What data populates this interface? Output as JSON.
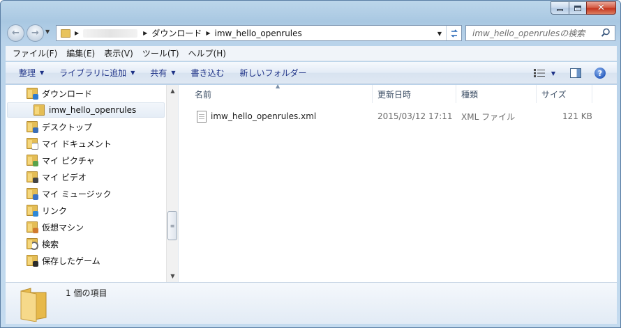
{
  "window": {
    "caption": {
      "min_icon": "minimize-icon",
      "max_icon": "maximize-icon",
      "close_glyph": "✕"
    }
  },
  "nav": {
    "back_icon": "back-arrow-icon",
    "forward_icon": "forward-arrow-icon",
    "address": {
      "crumbs": [
        "ダウンロード",
        "imw_hello_openrules"
      ],
      "refresh_icon": "refresh-icon"
    },
    "search": {
      "placeholder": "imw_hello_openrulesの検索",
      "icon": "search-icon"
    }
  },
  "menubar": {
    "items": [
      "ファイル(F)",
      "編集(E)",
      "表示(V)",
      "ツール(T)",
      "ヘルプ(H)"
    ]
  },
  "commandbar": {
    "organize": "整理",
    "add_to_library": "ライブラリに追加",
    "share": "共有",
    "burn": "書き込む",
    "new_folder": "新しいフォルダー"
  },
  "sidebar": {
    "items": [
      {
        "label": "ダウンロード",
        "icon": "downloads-folder-icon"
      },
      {
        "label": "imw_hello_openrules",
        "icon": "folder-icon",
        "selected": true
      },
      {
        "label": "デスクトップ",
        "icon": "desktop-folder-icon"
      },
      {
        "label": "マイ ドキュメント",
        "icon": "documents-folder-icon"
      },
      {
        "label": "マイ ピクチャ",
        "icon": "pictures-folder-icon"
      },
      {
        "label": "マイ ビデオ",
        "icon": "videos-folder-icon"
      },
      {
        "label": "マイ ミュージック",
        "icon": "music-folder-icon"
      },
      {
        "label": "リンク",
        "icon": "links-folder-icon"
      },
      {
        "label": "仮想マシン",
        "icon": "virtual-machines-folder-icon"
      },
      {
        "label": "検索",
        "icon": "searches-folder-icon"
      },
      {
        "label": "保存したゲーム",
        "icon": "saved-games-folder-icon"
      }
    ]
  },
  "filelist": {
    "columns": [
      "名前",
      "更新日時",
      "種類",
      "サイズ"
    ],
    "rows": [
      {
        "name": "imw_hello_openrules.xml",
        "modified": "2015/03/12 17:11",
        "type": "XML ファイル",
        "size": "121 KB"
      }
    ]
  },
  "details": {
    "status": "1 個の項目"
  },
  "colors": {
    "accent": "#1e3287",
    "window_frame": "#a9c8e2",
    "close_button": "#c3301a"
  }
}
